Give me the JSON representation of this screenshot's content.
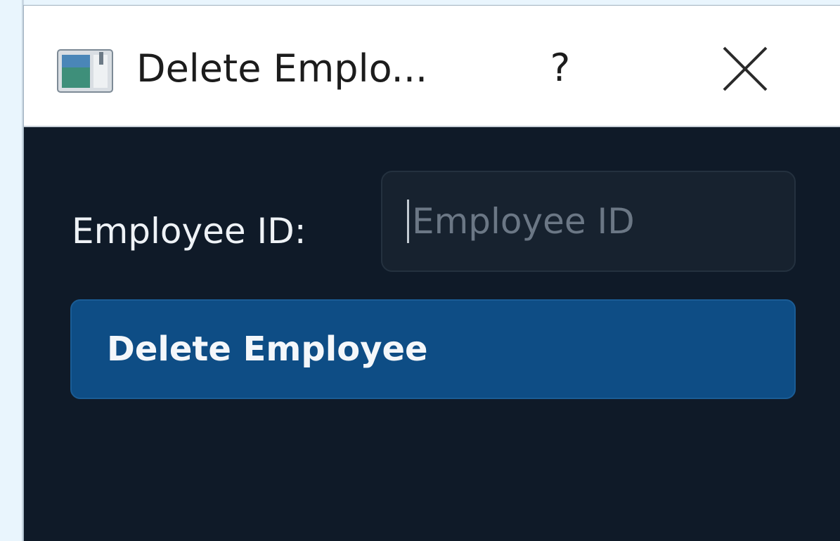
{
  "window": {
    "title": "Delete Emplo...",
    "help_label": "?",
    "icons": {
      "app": "app-window-icon",
      "close": "close-icon"
    }
  },
  "form": {
    "employee_id_label": "Employee ID:",
    "employee_id_placeholder": "Employee ID",
    "employee_id_value": ""
  },
  "actions": {
    "delete_label": "Delete Employee"
  },
  "colors": {
    "dialog_bg": "#0f1a28",
    "input_bg": "#17222f",
    "button_bg": "#0e4d85",
    "page_bg": "#e9f5fd"
  }
}
